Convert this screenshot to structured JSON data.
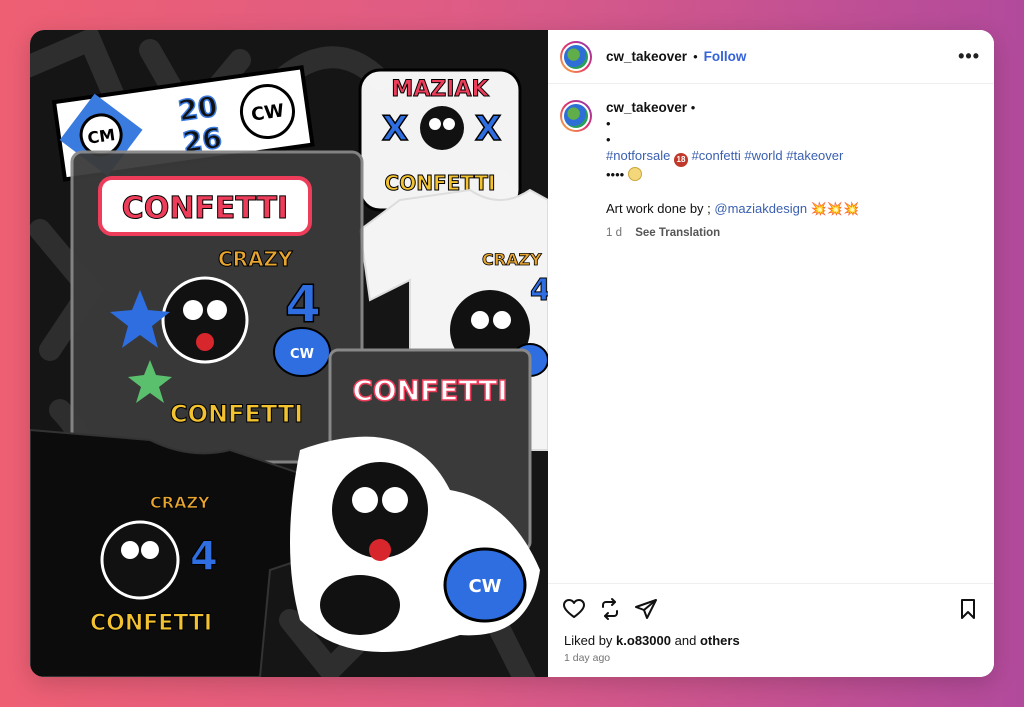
{
  "post": {
    "username": "cw_takeover",
    "separator": "•",
    "follow_label": "Follow",
    "more_label": "•••"
  },
  "caption": {
    "username": "cw_takeover",
    "separator": "•",
    "bullet1": "•",
    "bullet2": "•",
    "hashtag1": "#notforsale",
    "badge": "18",
    "hashtags": "#confetti #world #takeover",
    "dots": "••••",
    "credit": "Art work done by ;",
    "mention": "@maziakdesign",
    "bursts": "💥💥💥",
    "age": "1 d",
    "see_translation": "See Translation"
  },
  "art_text": {
    "confetti": "CONFETTI",
    "crazy": "CRAZY",
    "four": "4",
    "maziak": "MAZIAK",
    "year_top": "20",
    "year_bottom": "26",
    "cw": "CW",
    "cm": "CM",
    "x": "X"
  },
  "icons": [
    "heart-icon",
    "repost-icon",
    "share-icon",
    "bookmark-icon",
    "more-icon"
  ],
  "likes": {
    "prefix": "Liked by",
    "user": "k.o83000",
    "joiner": "and",
    "suffix": "others",
    "time_ago": "1 day ago"
  },
  "colors": {
    "link": "#3563d9",
    "hashtag": "#3a5fb0",
    "bg_left": "#ee5f73",
    "bg_right": "#b24a9c"
  }
}
